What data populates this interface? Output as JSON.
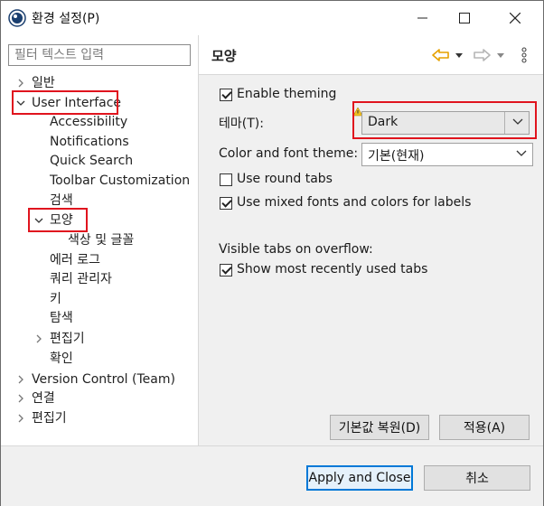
{
  "window": {
    "title": "환경 설정(P)"
  },
  "filter": {
    "placeholder": "필터 텍스트 입력"
  },
  "tree": [
    {
      "label": "일반"
    },
    {
      "label": "User Interface"
    },
    {
      "label": "Accessibility"
    },
    {
      "label": "Notifications"
    },
    {
      "label": "Quick Search"
    },
    {
      "label": "Toolbar Customization"
    },
    {
      "label": "검색"
    },
    {
      "label": "모양"
    },
    {
      "label": "색상 및 글꼴"
    },
    {
      "label": "에러 로그"
    },
    {
      "label": "쿼리 관리자"
    },
    {
      "label": "키"
    },
    {
      "label": "탐색"
    },
    {
      "label": "편집기"
    },
    {
      "label": "확인"
    },
    {
      "label": "Version Control (Team)"
    },
    {
      "label": "연결"
    },
    {
      "label": "편집기"
    }
  ],
  "page": {
    "title": "모양",
    "enable_theming": {
      "label": "Enable theming",
      "checked": true
    },
    "theme": {
      "label": "테마(T):",
      "value": "Dark"
    },
    "color_font_theme": {
      "label": "Color and font theme:",
      "value": "기본(현재)"
    },
    "round_tabs": {
      "label": "Use round tabs",
      "checked": false
    },
    "mixed_fonts": {
      "label": "Use mixed fonts and colors for labels",
      "checked": true
    },
    "overflow_heading": "Visible tabs on overflow:",
    "recent_tabs": {
      "label": "Show most recently used tabs",
      "checked": true
    },
    "restore_defaults": "기본값 복원(D)",
    "apply": "적용(A)"
  },
  "footer": {
    "apply_close": "Apply and Close",
    "cancel": "취소"
  },
  "colors": {
    "highlight": "#e0141e",
    "nav_back": "#e6a100",
    "primary_border": "#0078d7"
  }
}
